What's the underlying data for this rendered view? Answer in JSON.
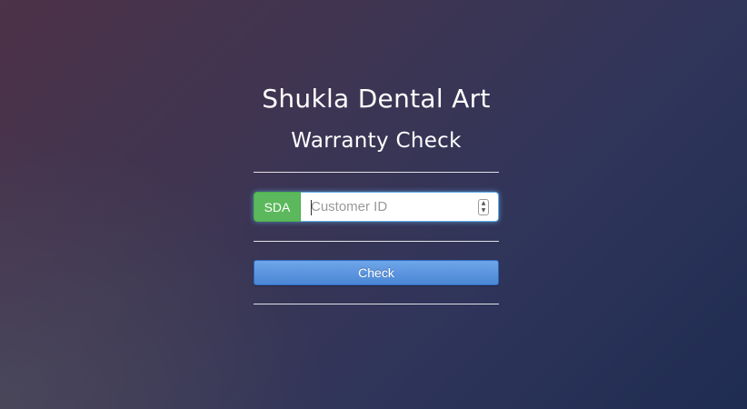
{
  "header": {
    "title": "Shukla Dental Art",
    "subtitle": "Warranty Check"
  },
  "form": {
    "prefix_label": "SDA",
    "customer_id": {
      "placeholder": "Customer ID",
      "value": ""
    },
    "stepper_up_icon": "chevron-up-icon",
    "stepper_down_icon": "chevron-down-icon",
    "submit_label": "Check"
  },
  "colors": {
    "prefix_addon": "#5cb85c",
    "button": "#4a86d4",
    "focus_ring": "#66afe9"
  }
}
